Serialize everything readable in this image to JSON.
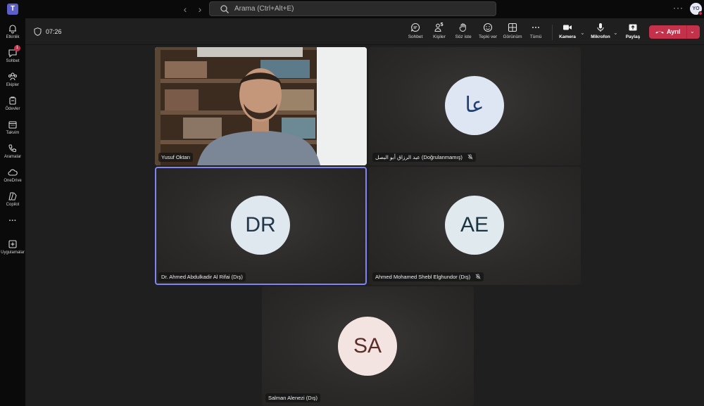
{
  "titlebar": {
    "search_placeholder": "Arama (Ctrl+Alt+E)",
    "more": "···",
    "avatar_initials": "YO"
  },
  "rail": {
    "items": [
      {
        "label": "Etkinlik",
        "icon": "bell-icon"
      },
      {
        "label": "Sohbet",
        "icon": "chat-icon",
        "badge": "1"
      },
      {
        "label": "Ekipler",
        "icon": "teams-icon"
      },
      {
        "label": "Ödevler",
        "icon": "assignments-icon"
      },
      {
        "label": "Takvim",
        "icon": "calendar-icon"
      },
      {
        "label": "Aramalar",
        "icon": "phone-icon"
      },
      {
        "label": "OneDrive",
        "icon": "cloud-icon"
      },
      {
        "label": "Copilot",
        "icon": "copilot-icon"
      },
      {
        "label": "···",
        "icon": "more-icon"
      },
      {
        "label": "Uygulamalar",
        "icon": "apps-icon"
      }
    ]
  },
  "meeting": {
    "timer": "07:26",
    "controls": {
      "chat": "Sohbet",
      "people": "Kişiler",
      "people_count": "5",
      "raise_hand": "Söz iste",
      "react": "Tepki ver",
      "view": "Görünüm",
      "more": "Tümü",
      "camera": "Kamera",
      "mic": "Mikrofon",
      "share": "Paylaş",
      "leave": "Ayrıl"
    },
    "tiles": [
      {
        "name": "Yusuf Oktarı",
        "type": "video",
        "muted": false
      },
      {
        "name": "عبد الرزاق أبو البصل (Doğrulanmamış)",
        "initials": "عا",
        "muted": true,
        "avatar_bg": "#dfe6f3",
        "avatar_fg": "#1f3f74"
      },
      {
        "name": "Dr. Ahmed Abdulkadir Al Rifai (Dış)",
        "initials": "DR",
        "muted": false,
        "active": true,
        "avatar_bg": "#dfe7ef",
        "avatar_fg": "#22364a"
      },
      {
        "name": "Ahmed Mohamed Shebl Elghundor (Dış)",
        "initials": "AE",
        "muted": true,
        "avatar_bg": "#dfe9ee",
        "avatar_fg": "#1c3440"
      },
      {
        "name": "Salman Alenezi (Dış)",
        "initials": "SA",
        "muted": false,
        "avatar_bg": "#f4e4e1",
        "avatar_fg": "#5a2e28"
      }
    ]
  },
  "colors": {
    "accent": "#5b5fc7",
    "leave_red": "#c4314b",
    "active_border": "#7f85f5"
  }
}
